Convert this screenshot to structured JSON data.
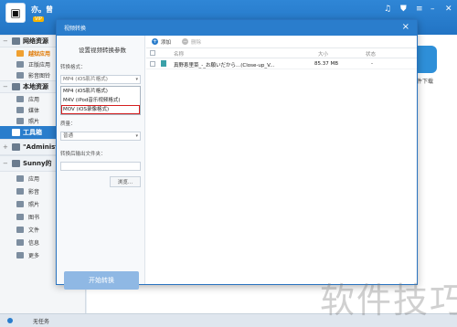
{
  "app": {
    "username": "亦。曾 ",
    "vip": "VIP",
    "icons": [
      "music-icon",
      "shirt-icon",
      "menu-icon",
      "minimize-icon",
      "close-icon"
    ]
  },
  "sidebar": {
    "network_section": "网络资源",
    "network_items": [
      {
        "label": "越狱应用",
        "highlight": true
      },
      {
        "label": "正版应用",
        "highlight": false
      },
      {
        "label": "影音图铃",
        "highlight": false
      }
    ],
    "local_section": "本地资源",
    "local_items": [
      "应用",
      "媒体",
      "照片"
    ],
    "toolbox": "工具箱",
    "admin_section": "\"Administ",
    "sunny_section": "Sunny的",
    "sunny_items": [
      "应用",
      "影音",
      "照片",
      "图书",
      "文件",
      "信息",
      "更多"
    ],
    "status": "无任务"
  },
  "right_app": {
    "label": "件下载"
  },
  "dialog": {
    "title": "视频转换",
    "settings_title": "设置视频转换参数",
    "format_label": "转换格式：",
    "format_selected": "MP4 (iOS影片格式)",
    "format_options": [
      "MP4 (iOS影片格式)",
      "M4V (iPod音乐视频格式)",
      "MOV (iOS录像格式)"
    ],
    "selected_option_index": 2,
    "quality_label": "质量：",
    "quality_value": "普通",
    "output_label": "转换后输出文件夹：",
    "browse_label": "浏览...",
    "start_label": "开始转换",
    "toolbar": {
      "add": "添加",
      "delete": "删除"
    },
    "columns": {
      "name": "名称",
      "size": "大小",
      "status": "状态"
    },
    "files": [
      {
        "name": "真野恵里菜_-_お願いだから...(Close-up_V...",
        "size": "85.37 MB",
        "status": "-"
      }
    ]
  },
  "watermark": "软件技巧"
}
